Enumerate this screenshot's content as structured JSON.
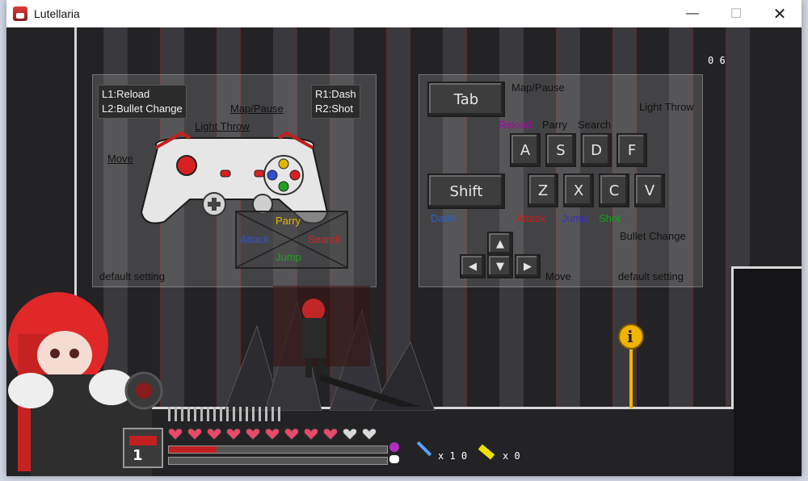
{
  "window": {
    "title": "Lutellaria",
    "minimize_glyph": "—",
    "maximize_glyph": "☐",
    "close_glyph": "✕"
  },
  "hud": {
    "counter_top_right": "0 6",
    "knife_count": "x 1 0",
    "key_count": "x 0",
    "weapon_slot_number": "1",
    "hearts_full": 9,
    "hearts_empty": 2,
    "health_bar_fraction": 0.22,
    "exp_bar_fraction": 0.0
  },
  "gamepad_panel": {
    "l1": "L1:Reload",
    "l2": "L2:Bullet Change",
    "r1": "R1:Dash",
    "r2": "R2:Shot",
    "map_pause": "Map/Pause",
    "light_throw": "Light Throw",
    "move": "Move",
    "parry": "Parry",
    "attack": "Attack",
    "search": "Search",
    "jump": "Jump",
    "footer": "default setting"
  },
  "keyboard_panel": {
    "tab_key": "Tab",
    "map_pause": "Map/Pause",
    "light_throw": "Light Throw",
    "reload": "Reload",
    "parry": "Parry",
    "search": "Search",
    "key_a": "A",
    "key_s": "S",
    "key_d": "D",
    "key_f": "F",
    "shift_key": "Shift",
    "key_z": "Z",
    "key_x": "X",
    "key_c": "C",
    "key_v": "V",
    "dash": "Dash",
    "attack": "Attack",
    "jump": "Jump",
    "shot": "Shot",
    "bullet_change": "Bullet Change",
    "move": "Move",
    "footer": "default setting"
  },
  "info_sign": {
    "glyph": "i"
  },
  "colors": {
    "reload": "#b000b0",
    "dash": "#2a60c8",
    "attack": "#d01818",
    "jump": "#3a2ad0",
    "shot": "#18a018",
    "hair": "#e02828",
    "sign": "#f0b400"
  }
}
